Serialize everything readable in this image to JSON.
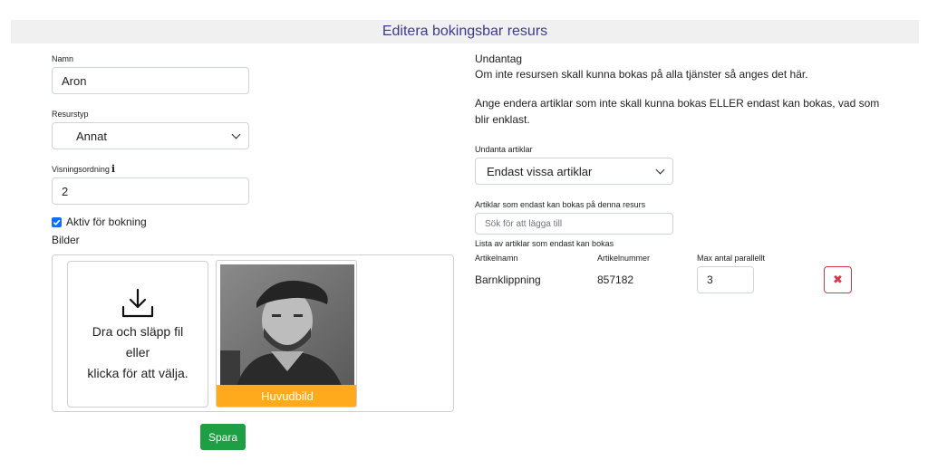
{
  "header": {
    "title": "Editera bokingsbar resurs"
  },
  "form": {
    "name_label": "Namn",
    "name_value": "Aron",
    "type_label": "Resurstyp",
    "type_value": "Annat",
    "order_label": "Visningsordning",
    "order_value": "2",
    "active_label": "Aktiv för bokning",
    "active_checked": true,
    "images_label": "Bilder",
    "dropzone_line1": "Dra och släpp fil",
    "dropzone_line2": "eller",
    "dropzone_line3": "klicka för att välja.",
    "main_image_badge": "Huvudbild",
    "save_label": "Spara"
  },
  "exceptions": {
    "heading": "Undantag",
    "desc1": "Om inte resursen skall kunna bokas på alla tjänster så anges det här.",
    "desc2_line1": "Ange endera artiklar som inte skall kunna bokas ELLER endast kan bokas, vad som",
    "desc2_line2": "blir enklast.",
    "except_label": "Undanta artiklar",
    "except_value": "Endast vissa artiklar",
    "only_label": "Artiklar som endast kan bokas på denna resurs",
    "search_placeholder": "Sök för att lägga till",
    "list_label": "Lista av artiklar som endast kan bokas",
    "columns": [
      "Artikelnamn",
      "Artikelnummer",
      "Max antal parallellt"
    ],
    "rows": [
      {
        "name": "Barnklippning",
        "number": "857182",
        "max_parallel": "3"
      }
    ]
  },
  "icons": {
    "info": "info-icon",
    "download": "download-icon",
    "delete": "close-icon"
  },
  "colors": {
    "title": "#3d3b8e",
    "save": "#1e9f44",
    "badge": "#ffaa1d",
    "delete": "#dc3545",
    "checkbox": "#0d6efd"
  }
}
